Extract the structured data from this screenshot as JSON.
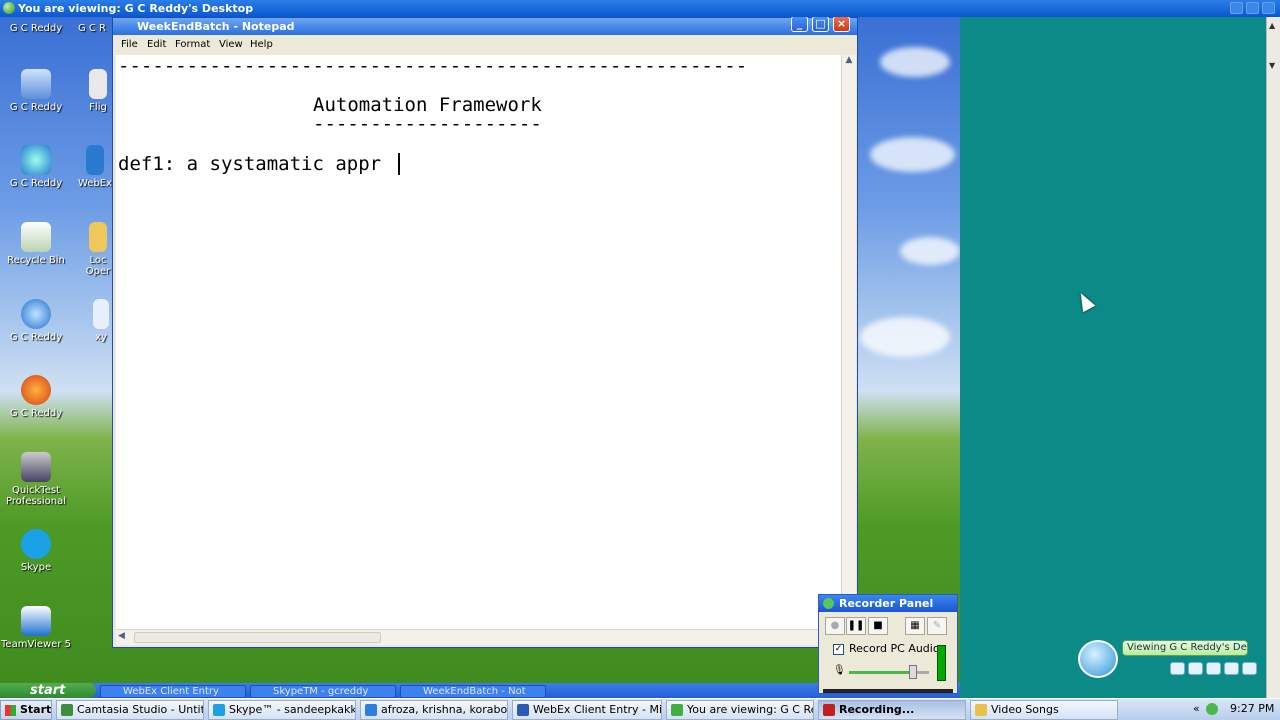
{
  "viewer": {
    "title": "You are viewing: G C Reddy's Desktop"
  },
  "desktop_icons": [
    {
      "label": "G C Reddy"
    },
    {
      "label": "G C R"
    },
    {
      "label": "G C Reddy"
    },
    {
      "label": "Flig"
    },
    {
      "label": "G C Reddy"
    },
    {
      "label": "WebEx"
    },
    {
      "label": "Recycle Bin"
    },
    {
      "label": "Loc Oper"
    },
    {
      "label": "G C Reddy"
    },
    {
      "label": "xy"
    },
    {
      "label": "G C Reddy"
    },
    {
      "label": "QuickTest Professional"
    },
    {
      "label": "Skype"
    },
    {
      "label": "TeamViewer 5"
    }
  ],
  "notepad": {
    "title": "WeekEndBatch - Notepad",
    "menu": [
      "File",
      "Edit",
      "Format",
      "View",
      "Help"
    ],
    "lines": {
      "dashes_top": "-------------------------------------------------------",
      "heading": "Automation Framework",
      "underline": "--------------------",
      "def": "def1: a systamatic appr"
    }
  },
  "remote_taskbar": {
    "start": "start",
    "items": [
      "WebEx Client Entry",
      "SkypeTM - gcreddy",
      "WeekEndBatch - Not"
    ]
  },
  "recorder": {
    "title": "Recorder Panel",
    "record_audio_label": "Record PC Audio",
    "record_audio_checked": true,
    "volume_level": 0.8
  },
  "webex": {
    "viewing_label": "Viewing G C Reddy's De..."
  },
  "taskbar": {
    "start": "Start",
    "items": [
      {
        "label": "Camtasia Studio - Untitle...",
        "icon_color": "#3c8f3c",
        "active": false
      },
      {
        "label": "Skype™ - sandeepkakka...",
        "icon_color": "#1aa1e6",
        "active": false
      },
      {
        "label": "afroza, krishna, koraboin...",
        "icon_color": "#2e7de0",
        "active": false
      },
      {
        "label": "WebEx Client Entry - Mic...",
        "icon_color": "#2a59b8",
        "active": false
      },
      {
        "label": "You are viewing: G C Re...",
        "icon_color": "#3fb03f",
        "active": false
      },
      {
        "label": "Recording...",
        "icon_color": "#c02020",
        "active": true
      },
      {
        "label": "Video Songs",
        "icon_color": "#e8c04a",
        "active": false
      }
    ],
    "clock": "9:27 PM"
  }
}
